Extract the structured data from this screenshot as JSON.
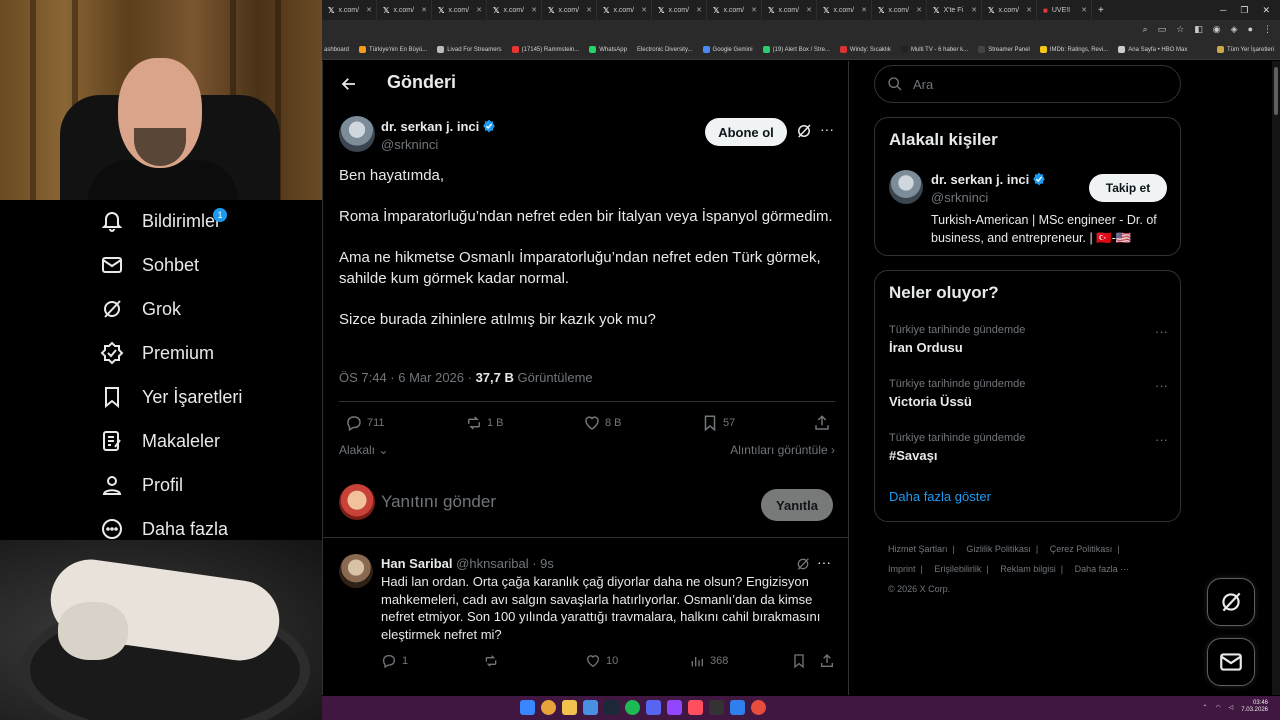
{
  "browser": {
    "tabs": [
      "x.com/",
      "x.com/",
      "x.com/",
      "x.com/",
      "x.com/",
      "x.com/",
      "x.com/",
      "x.com/",
      "x.com/",
      "x.com/",
      "x.com/",
      "X'te Fi",
      "x.com/",
      "UVE!I"
    ],
    "bookmarks": [
      "ashboard",
      "Türkiye'nin En Büyü...",
      "Livad For Streamers",
      "(17145) Rammstein...",
      "WhatsApp",
      "Electronic Diversity...",
      "Google Gemini",
      "(19) Alert Box / Stre...",
      "Windy: Sıcaklık",
      "Multi TV - 6 haber k...",
      "Streamer Panel",
      "IMDb: Ratings, Revi...",
      "Ana Sayfa • HBO Max"
    ],
    "bookmarks_all": "Tüm Yer İşaretleri"
  },
  "nav": {
    "items": [
      {
        "label": "Bildirimler",
        "icon": "bell-icon"
      },
      {
        "label": "Sohbet",
        "icon": "mail-icon"
      },
      {
        "label": "Grok",
        "icon": "grok-icon"
      },
      {
        "label": "Premium",
        "icon": "verified-badge-icon"
      },
      {
        "label": "Yer İşaretleri",
        "icon": "bookmark-icon"
      },
      {
        "label": "Makaleler",
        "icon": "article-icon"
      },
      {
        "label": "Profil",
        "icon": "person-icon"
      },
      {
        "label": "Daha fazla",
        "icon": "more-circle-icon"
      }
    ],
    "notification_badge": "1"
  },
  "header": {
    "title": "Gönderi"
  },
  "tweet": {
    "author_name": "dr. serkan j. inci",
    "author_handle": "@srkninci",
    "follow_label": "Abone ol",
    "paragraphs": [
      "Ben hayatımda,",
      "Roma İmparatorluğu’ndan nefret eden bir İtalyan veya İspanyol görmedim.",
      "Ama ne hikmetse Osmanlı İmparatorluğu’ndan nefret eden Türk görmek, sahilde kum görmek kadar normal.",
      "Sizce burada zihinlere atılmış bir kazık yok mu?"
    ],
    "time": "ÖS 7:44 · 6 Mar 2026 · ",
    "views_value": "37,7 B",
    "views_label": " Görüntüleme",
    "stats": {
      "replies": "711",
      "reposts": "1 B",
      "likes": "8 B",
      "bookmarks": "57"
    },
    "relevant_label": "Alakalı",
    "quotes_label": "Alıntıları görüntüle"
  },
  "reply_box": {
    "placeholder": "Yanıtını gönder",
    "button": "Yanıtla"
  },
  "reply": {
    "name": "Han Saribal",
    "handle_time": " @hknsaribal · 9s",
    "text": "Hadi lan ordan. Orta çağa karanlık çağ diyorlar daha ne olsun? Engizisyon mahkemeleri, cadı avı salgın savaşlarla hatırlıyorlar. Osmanlı’dan da kimse nefret etmiyor. Son 100 yılında yarattığı travmalara, halkını cahil bırakmasını eleştirmek nefret mi?",
    "stats": {
      "replies": "1",
      "reposts": "",
      "likes": "10",
      "views": "368"
    }
  },
  "sidebar": {
    "search_placeholder": "Ara",
    "related_title": "Alakalı kişiler",
    "related": {
      "name": "dr. serkan j. inci",
      "handle": "@srkninci",
      "follow_label": "Takip et",
      "bio": "Turkish-American | MSc engineer - Dr. of business, and entrepreneur. | 🇹🇷-🇺🇸"
    },
    "trends_title": "Neler oluyor?",
    "trends": [
      {
        "context": "Türkiye tarihinde gündemde",
        "name": "İran Ordusu"
      },
      {
        "context": "Türkiye tarihinde gündemde",
        "name": "Victoria Üssü"
      },
      {
        "context": "Türkiye tarihinde gündemde",
        "name": "#Savaşı"
      }
    ],
    "show_more": "Daha fazla göster",
    "footer": [
      "Hizmet Şartları",
      "Gizlilik Politikası",
      "Çerez Politikası",
      "Imprint",
      "Erişilebilirlik",
      "Reklam bilgisi",
      "Daha fazla ···"
    ],
    "copyright": "© 2026 X Corp."
  },
  "taskbar": {
    "time": "03:46",
    "date": "7.03.2026"
  },
  "colors": {
    "accent": "#1d9bf0",
    "background": "#000000",
    "border": "#2f3336",
    "muted": "#71767b",
    "taskbar": "#3f1740"
  }
}
